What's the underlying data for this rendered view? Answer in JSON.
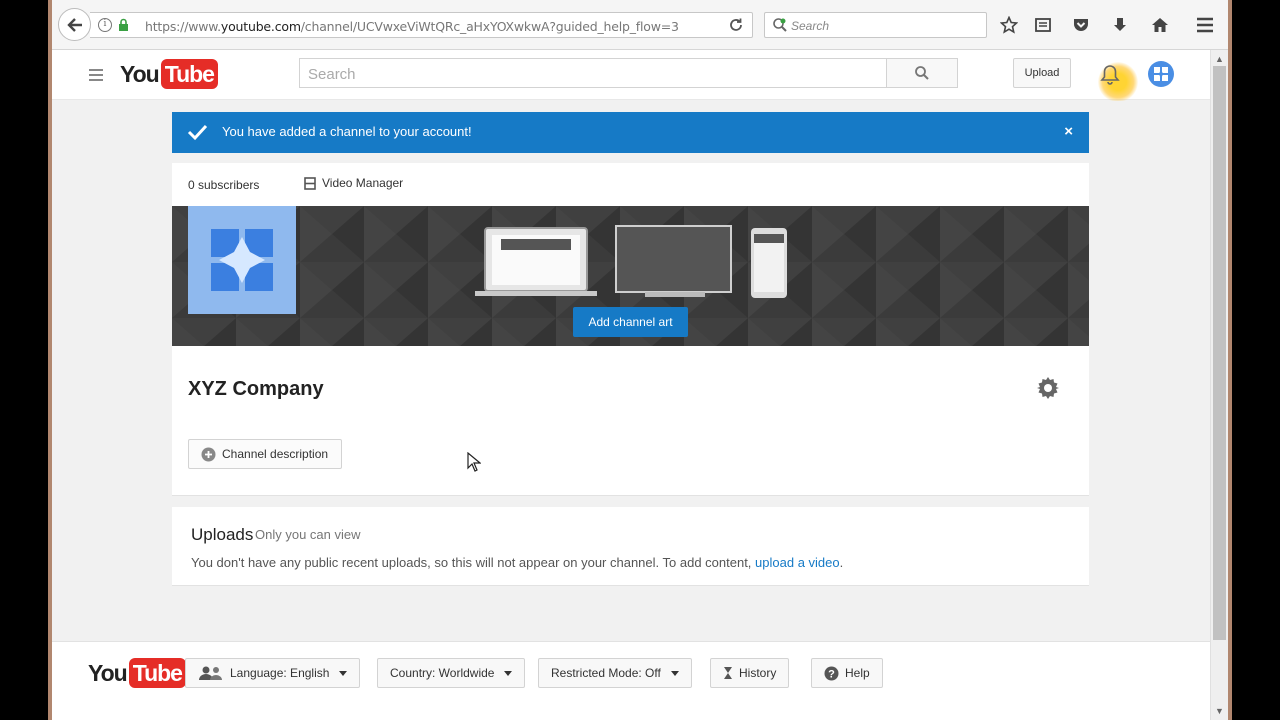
{
  "browser": {
    "url_prefix": "https://www.",
    "url_domain": "youtube.com",
    "url_rest": "/channel/UCVwxeViWtQRc_aHxYOXwkwA?guided_help_flow=3",
    "search_placeholder": "Search"
  },
  "header": {
    "logo_you": "You",
    "logo_tube": "Tube",
    "search_placeholder": "Search",
    "upload_label": "Upload"
  },
  "alert": {
    "message": "You have added a channel to your account!",
    "close": "×"
  },
  "channel_bar": {
    "subscribers": "0 subscribers",
    "video_manager": "Video Manager"
  },
  "banner": {
    "add_art_label": "Add channel art"
  },
  "channel": {
    "name": "XYZ Company",
    "description_button": "Channel description"
  },
  "uploads": {
    "title": "Uploads",
    "visibility": "Only you can view",
    "info_text": "You don't have any public recent uploads, so this will not appear on your channel. To add content, ",
    "info_link": "upload a video",
    "info_end": "."
  },
  "footer": {
    "logo_you": "You",
    "logo_tube": "Tube",
    "language": "Language: English",
    "country": "Country: Worldwide",
    "restricted": "Restricted Mode: Off",
    "history": "History",
    "help": "Help"
  },
  "colors": {
    "brand_red": "#e52d27",
    "accent_blue": "#167ac6",
    "banner_dark": "#3a3a3a",
    "channel_avatar": "#8fb9ee"
  }
}
